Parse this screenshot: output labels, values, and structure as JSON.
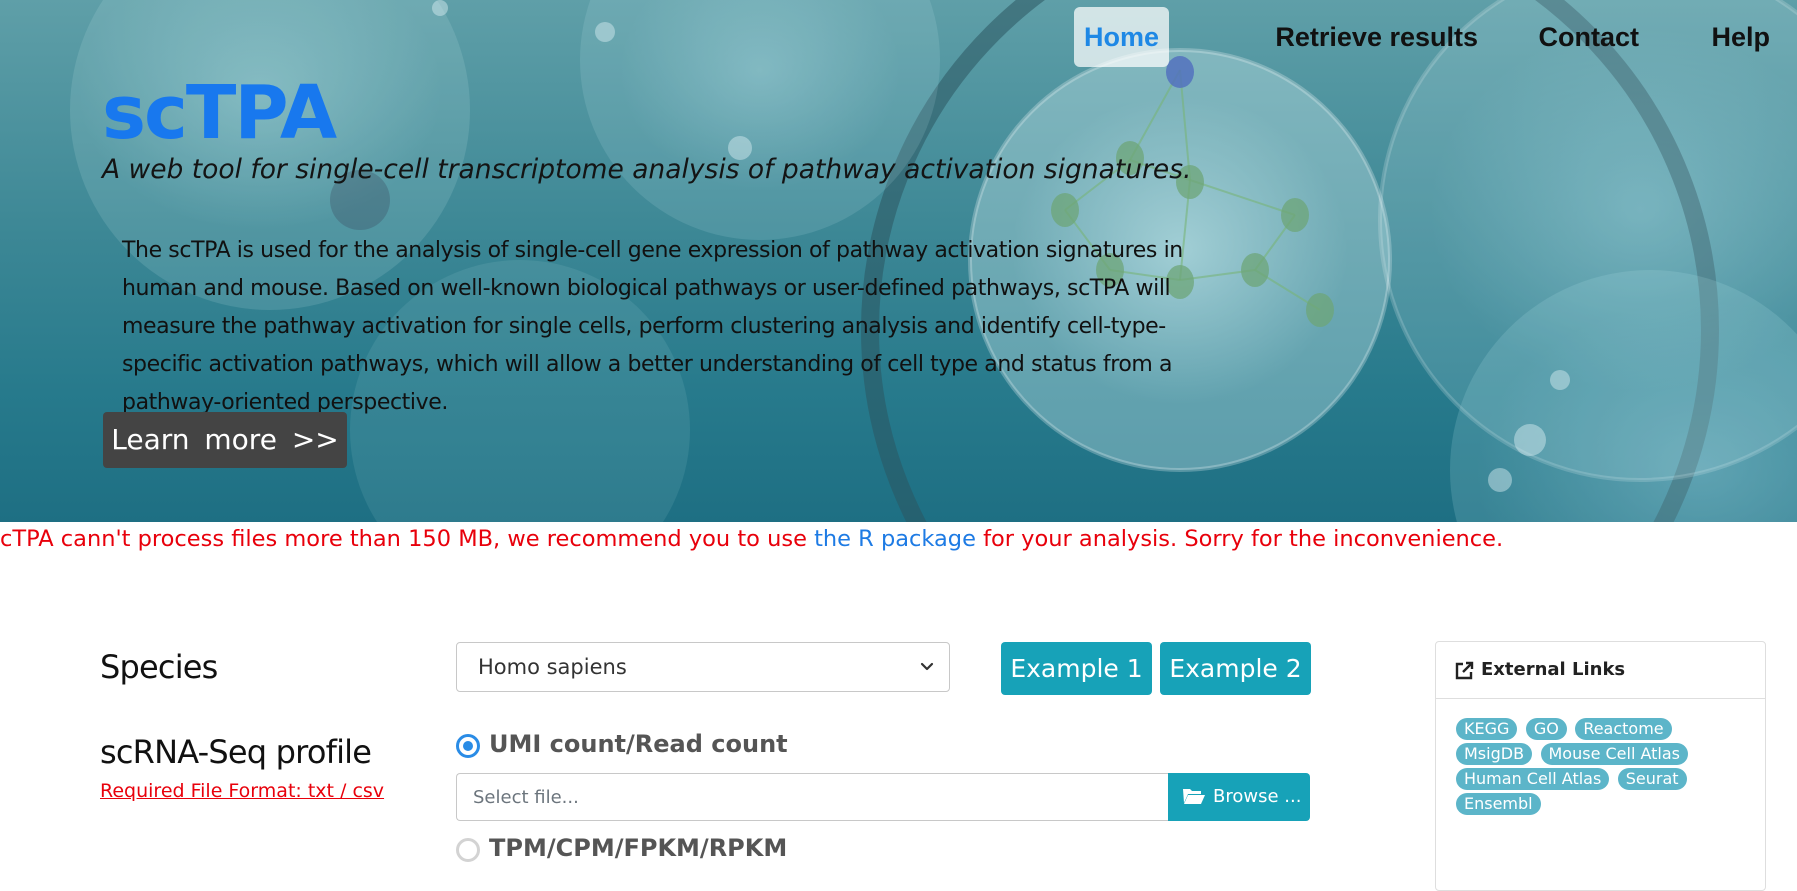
{
  "nav": {
    "items": [
      {
        "label": "Home",
        "active": true
      },
      {
        "label": "Retrieve results",
        "active": false
      },
      {
        "label": "Contact",
        "active": false
      },
      {
        "label": "Help",
        "active": false
      }
    ]
  },
  "hero": {
    "brand": "scTPA",
    "tagline": "A web tool for single-cell transcriptome analysis of pathway activation signatures.",
    "description": "The scTPA is used for the analysis of single-cell gene expression of pathway activation signatures in human and mouse. Based on well-known biological pathways or user-defined pathways, scTPA will measure the pathway activation for single cells, perform clustering analysis and identify cell-type-specific activation pathways, which will allow a better understanding of cell type and status from a pathway-oriented perspective.",
    "learn_more": "Learn  more  >>"
  },
  "warning": {
    "before": "cTPA cann't process files more than 150 MB, we recommend you to use ",
    "link": "the R package",
    "after": " for your analysis. Sorry for the inconvenience."
  },
  "form": {
    "species_label": "Species",
    "species_selected": "Homo sapiens",
    "example1": "Example 1",
    "example2": "Example 2",
    "profile_label": "scRNA-Seq profile",
    "required_format": "Required File Format: txt / csv",
    "radio_umi": "UMI count/Read count",
    "radio_tpm": "TPM/CPM/FPKM/RPKM",
    "file_placeholder": "Select file...",
    "browse": "Browse ..."
  },
  "external_links": {
    "title": "External Links",
    "links": [
      "KEGG",
      "GO",
      "Reactome",
      "MsigDB",
      "Mouse Cell Atlas",
      "Human Cell Atlas",
      "Seurat",
      "Ensembl"
    ]
  },
  "colors": {
    "accent_blue": "#1878ee",
    "teal": "#17a2b8",
    "warning_red": "#e8000b",
    "badge": "#5cb5c9"
  },
  "icons": {
    "select": "chevron-down-icon",
    "browse": "folder-open-icon",
    "external": "external-link-icon"
  }
}
